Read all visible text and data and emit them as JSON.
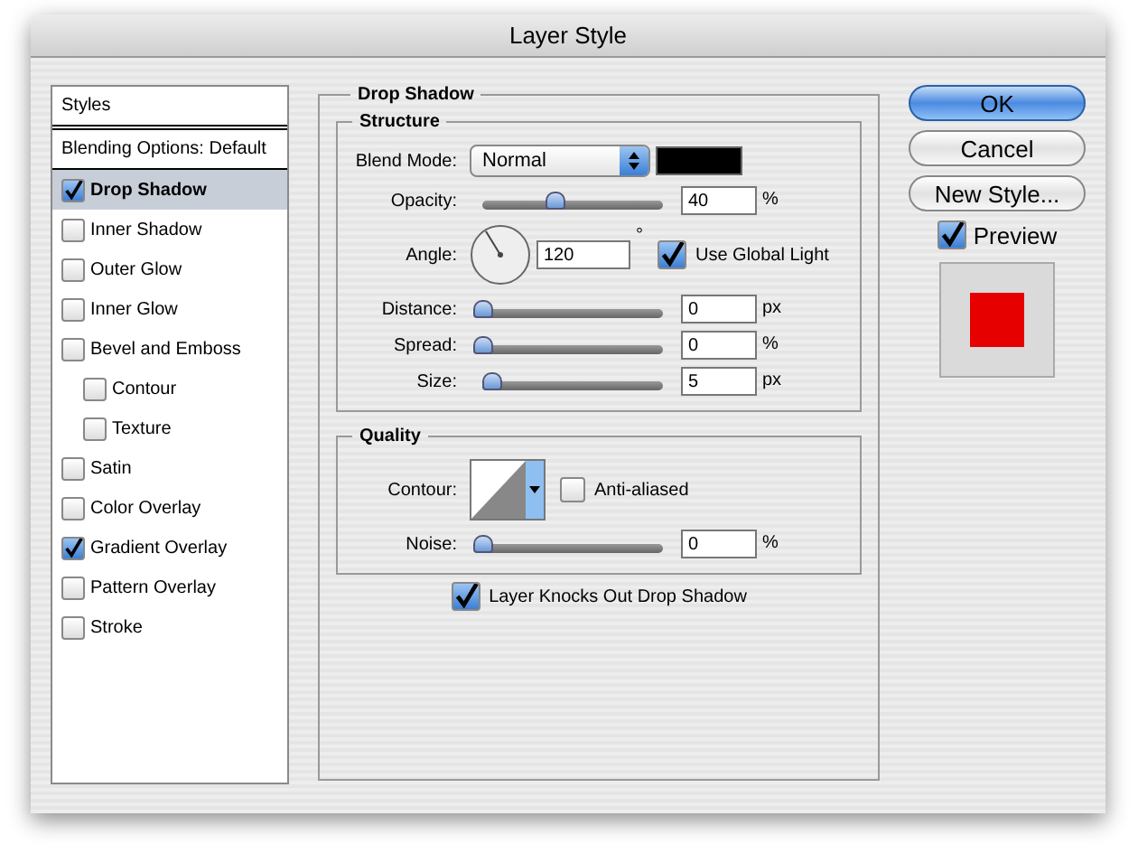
{
  "window": {
    "title": "Layer Style"
  },
  "sidebar": {
    "items": [
      {
        "kind": "header",
        "label": "Styles"
      },
      {
        "kind": "header",
        "label": "Blending Options: Default"
      },
      {
        "kind": "effect",
        "label": "Drop Shadow",
        "checked": true,
        "selected": true
      },
      {
        "kind": "effect",
        "label": "Inner Shadow",
        "checked": false,
        "selected": false
      },
      {
        "kind": "effect",
        "label": "Outer Glow",
        "checked": false,
        "selected": false
      },
      {
        "kind": "effect",
        "label": "Inner Glow",
        "checked": false,
        "selected": false
      },
      {
        "kind": "effect",
        "label": "Bevel and Emboss",
        "checked": false,
        "selected": false,
        "children": [
          {
            "kind": "effect",
            "label": "Contour",
            "checked": false,
            "selected": false
          },
          {
            "kind": "effect",
            "label": "Texture",
            "checked": false,
            "selected": false
          }
        ]
      },
      {
        "kind": "effect",
        "label": "Satin",
        "checked": false,
        "selected": false
      },
      {
        "kind": "effect",
        "label": "Color Overlay",
        "checked": false,
        "selected": false
      },
      {
        "kind": "effect",
        "label": "Gradient Overlay",
        "checked": true,
        "selected": false
      },
      {
        "kind": "effect",
        "label": "Pattern Overlay",
        "checked": false,
        "selected": false
      },
      {
        "kind": "effect",
        "label": "Stroke",
        "checked": false,
        "selected": false
      }
    ]
  },
  "panel": {
    "title": "Drop Shadow",
    "structure": {
      "title": "Structure",
      "rows": [
        {
          "kind": "select",
          "label": "Blend Mode:",
          "value": "Normal",
          "color": "#000000"
        },
        {
          "kind": "slider",
          "label": "Opacity:",
          "level": 0.4,
          "value": "40",
          "unit": "%"
        },
        {
          "kind": "angle",
          "label": "Angle:",
          "value": "120",
          "unit": "°",
          "option": {
            "label": "Use Global Light",
            "checked": true
          }
        },
        {
          "kind": "slider",
          "label": "Distance:",
          "level": 0,
          "value": "0",
          "unit": "px"
        },
        {
          "kind": "slider",
          "label": "Spread:",
          "level": 0,
          "value": "0",
          "unit": "%"
        },
        {
          "kind": "slider",
          "label": "Size:",
          "level": 0.05,
          "value": "5",
          "unit": "px"
        }
      ]
    },
    "quality": {
      "title": "Quality",
      "rows": [
        {
          "kind": "contour",
          "label": "Contour:",
          "option": {
            "label": "Anti-aliased",
            "checked": false
          }
        },
        {
          "kind": "slider",
          "label": "Noise:",
          "level": 0,
          "value": "0",
          "unit": "%"
        }
      ]
    },
    "knockout": {
      "label": "Layer Knocks Out Drop Shadow",
      "checked": true
    }
  },
  "buttons": [
    {
      "label": "OK",
      "kind": "default"
    },
    {
      "label": "Cancel",
      "kind": "normal"
    },
    {
      "label": "New Style...",
      "kind": "normal"
    }
  ],
  "preview": {
    "label": "Preview",
    "checked": true
  }
}
